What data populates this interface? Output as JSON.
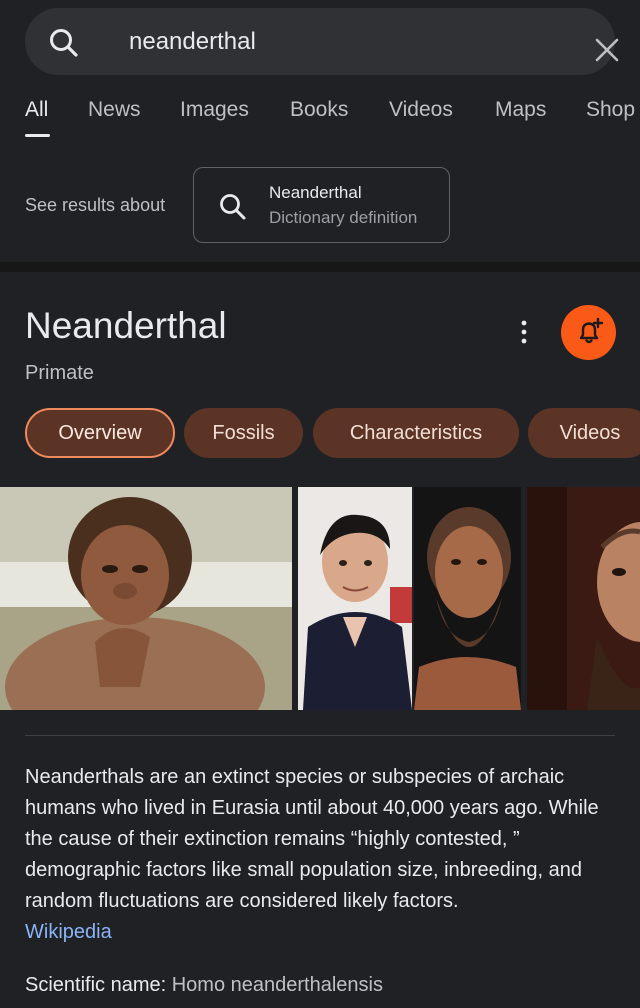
{
  "search": {
    "query": "neanderthal",
    "icon": "search-icon",
    "clear_icon": "close-icon"
  },
  "tabs": [
    {
      "label": "All",
      "active": true
    },
    {
      "label": "News"
    },
    {
      "label": "Images"
    },
    {
      "label": "Books"
    },
    {
      "label": "Videos"
    },
    {
      "label": "Maps"
    },
    {
      "label": "Shop"
    }
  ],
  "see_results": {
    "label": "See results about",
    "card_title": "Neanderthal",
    "card_subtitle": "Dictionary definition"
  },
  "knowledge_panel": {
    "title": "Neanderthal",
    "subtitle": "Primate",
    "follow_color": "#fa5a17",
    "chips": [
      {
        "label": "Overview",
        "active": true
      },
      {
        "label": "Fossils"
      },
      {
        "label": "Characteristics"
      },
      {
        "label": "Videos"
      }
    ],
    "images": [
      {
        "name": "neanderthal-reconstruction-thinking"
      },
      {
        "name": "actor-portrait"
      },
      {
        "name": "neanderthal-museum-bust"
      },
      {
        "name": "neanderthal-model-partial"
      }
    ],
    "description": "Neanderthals are an extinct species or subspecies of archaic humans who lived in Eurasia until about 40,000 years ago. While the cause of their extinction remains “highly contested, ” demographic factors like small population size, inbreeding, and random fluctuations are considered likely factors.",
    "source_link": "Wikipedia",
    "scientific_name_label": "Scientific name: ",
    "scientific_name_value": "Homo neanderthalensis"
  }
}
